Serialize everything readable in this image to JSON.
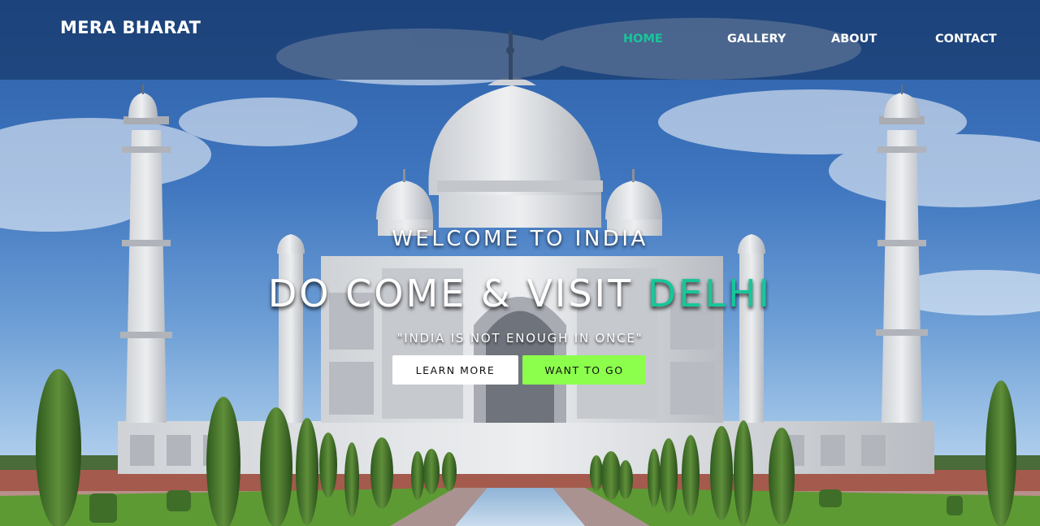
{
  "navbar": {
    "brand": "MERA BHARAT",
    "items": [
      {
        "label": "HOME",
        "active": true
      },
      {
        "label": "GALLERY",
        "active": false
      },
      {
        "label": "ABOUT",
        "active": false
      },
      {
        "label": "CONTACT",
        "active": false
      }
    ]
  },
  "hero": {
    "welcome": "WELCOME TO INDIA",
    "headline_prefix": "DO COME & VISIT ",
    "headline_city": "DELHI",
    "quote": "\"INDIA IS NOT ENOUGH IN ONCE\"",
    "background_image": "taj-mahal-photo"
  },
  "buttons": {
    "learn_more": "LEARN MORE",
    "want_to_go": "WANT TO GO"
  },
  "colors": {
    "accent": "#16c79a",
    "want_to_go_bg": "#8cff4d",
    "navbar_overlay": "#14325f"
  }
}
